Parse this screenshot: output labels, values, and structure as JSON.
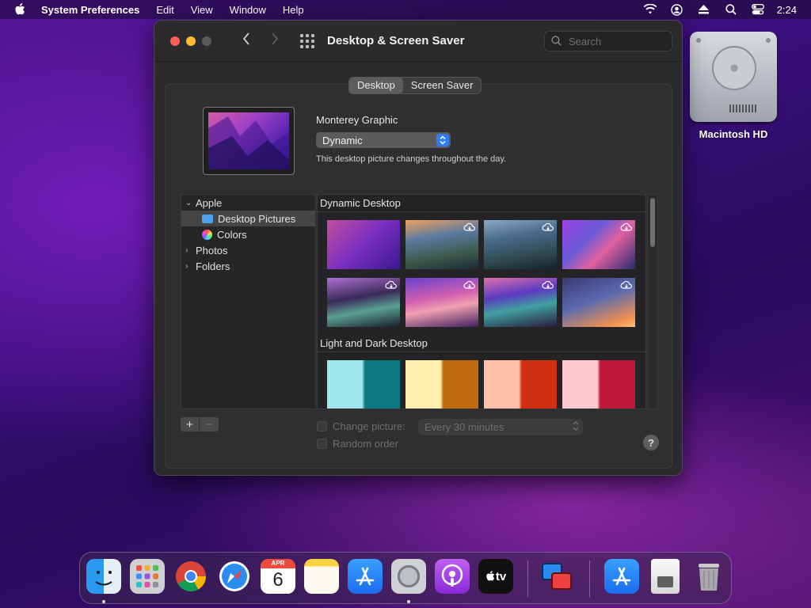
{
  "menubar": {
    "app_name": "System Preferences",
    "items": [
      "Edit",
      "View",
      "Window",
      "Help"
    ],
    "clock": "2:24"
  },
  "desktop_icons": [
    {
      "label": "Macintosh HD",
      "icon": "hard-drive-icon"
    }
  ],
  "window": {
    "title": "Desktop & Screen Saver",
    "search_placeholder": "Search",
    "tabs": [
      {
        "label": "Desktop",
        "active": true
      },
      {
        "label": "Screen Saver",
        "active": false
      }
    ],
    "picture_name": "Monterey Graphic",
    "mode_select": "Dynamic",
    "mode_description": "This desktop picture changes throughout the day.",
    "sidebar": {
      "groups": [
        {
          "label": "Apple",
          "expanded": true,
          "children": [
            {
              "label": "Desktop Pictures",
              "selected": true,
              "icon": "folder-icon"
            },
            {
              "label": "Colors",
              "selected": false,
              "icon": "color-wheel-icon"
            }
          ]
        },
        {
          "label": "Photos",
          "expanded": false
        },
        {
          "label": "Folders",
          "expanded": false
        }
      ]
    },
    "sections": [
      {
        "title": "Dynamic Desktop"
      },
      {
        "title": "Light and Dark Desktop"
      }
    ],
    "add_label": "+",
    "remove_label": "−",
    "change_picture_label": "Change picture:",
    "change_picture_checked": false,
    "interval": "Every 30 minutes",
    "random_order_label": "Random order",
    "random_order_checked": false,
    "help_label": "?"
  },
  "dock": {
    "apps": [
      {
        "name": "finder-icon",
        "running": true
      },
      {
        "name": "launchpad-icon",
        "running": false
      },
      {
        "name": "chrome-icon",
        "running": false
      },
      {
        "name": "safari-icon",
        "running": false
      },
      {
        "name": "calendar-icon",
        "running": false,
        "month": "APR",
        "day": "6"
      },
      {
        "name": "notes-icon",
        "running": false
      },
      {
        "name": "app-store-icon",
        "running": false
      },
      {
        "name": "system-preferences-icon",
        "running": true
      },
      {
        "name": "podcasts-icon",
        "running": false
      },
      {
        "name": "apple-tv-icon",
        "running": false,
        "label": "tv"
      },
      {
        "name": "remote-desktop-icon",
        "running": false
      },
      {
        "name": "app-store-folder-icon",
        "running": false
      },
      {
        "name": "preview-document-icon",
        "running": false
      },
      {
        "name": "trash-icon",
        "running": false
      }
    ]
  }
}
